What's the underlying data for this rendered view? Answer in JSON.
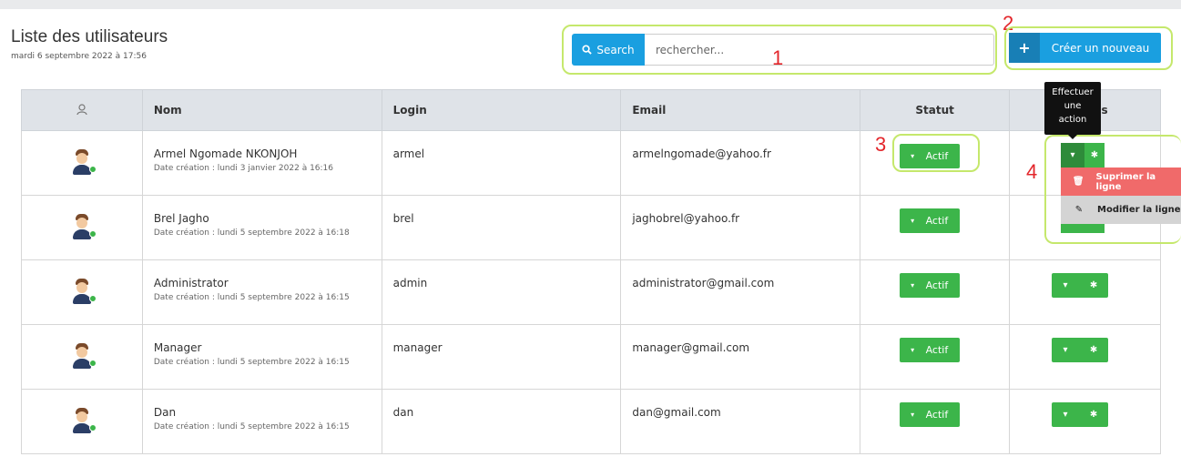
{
  "header": {
    "title": "Liste des utilisateurs",
    "subtitle": "mardi 6 septembre 2022 à 17:56"
  },
  "search": {
    "button_label": "Search",
    "placeholder": "rechercher..."
  },
  "create_button": {
    "label": "Créer un nouveau"
  },
  "annotations": {
    "a1": "1",
    "a2": "2",
    "a3": "3",
    "a4": "4"
  },
  "table": {
    "headers": {
      "avatar": "",
      "name": "Nom",
      "login": "Login",
      "email": "Email",
      "status": "Statut",
      "actions": "Actions"
    },
    "rows": [
      {
        "name": "Armel Ngomade NKONJOH",
        "date": "Date création : lundi 3 janvier 2022 à 16:16",
        "login": "armel",
        "email": "armelngomade@yahoo.fr",
        "status": "Actif"
      },
      {
        "name": "Brel Jagho",
        "date": "Date création : lundi 5 septembre 2022 à 16:18",
        "login": "brel",
        "email": "jaghobrel@yahoo.fr",
        "status": "Actif"
      },
      {
        "name": "Administrator",
        "date": "Date création : lundi 5 septembre 2022 à 16:15",
        "login": "admin",
        "email": "administrator@gmail.com",
        "status": "Actif"
      },
      {
        "name": "Manager",
        "date": "Date création : lundi 5 septembre 2022 à 16:15",
        "login": "manager",
        "email": "manager@gmail.com",
        "status": "Actif"
      },
      {
        "name": "Dan",
        "date": "Date création : lundi 5 septembre 2022 à 16:15",
        "login": "dan",
        "email": "dan@gmail.com",
        "status": "Actif"
      }
    ]
  },
  "tooltip": {
    "line1": "Effectuer",
    "line2": "une",
    "line3": "action"
  },
  "action_menu": {
    "delete_label": "Suprimer la ligne",
    "edit_label": "Modifier la ligne"
  },
  "colors": {
    "primary": "#1a9fe0",
    "success": "#3cb54a",
    "danger": "#f06a6a",
    "highlight": "#c5e86c",
    "annotation": "#e3262b"
  },
  "icons": {
    "search": "search-icon",
    "plus": "plus-icon",
    "caret": "caret-down-icon",
    "gear": "gear-icon",
    "trash": "trash-icon",
    "pencil": "pencil-icon",
    "user": "user-icon"
  }
}
